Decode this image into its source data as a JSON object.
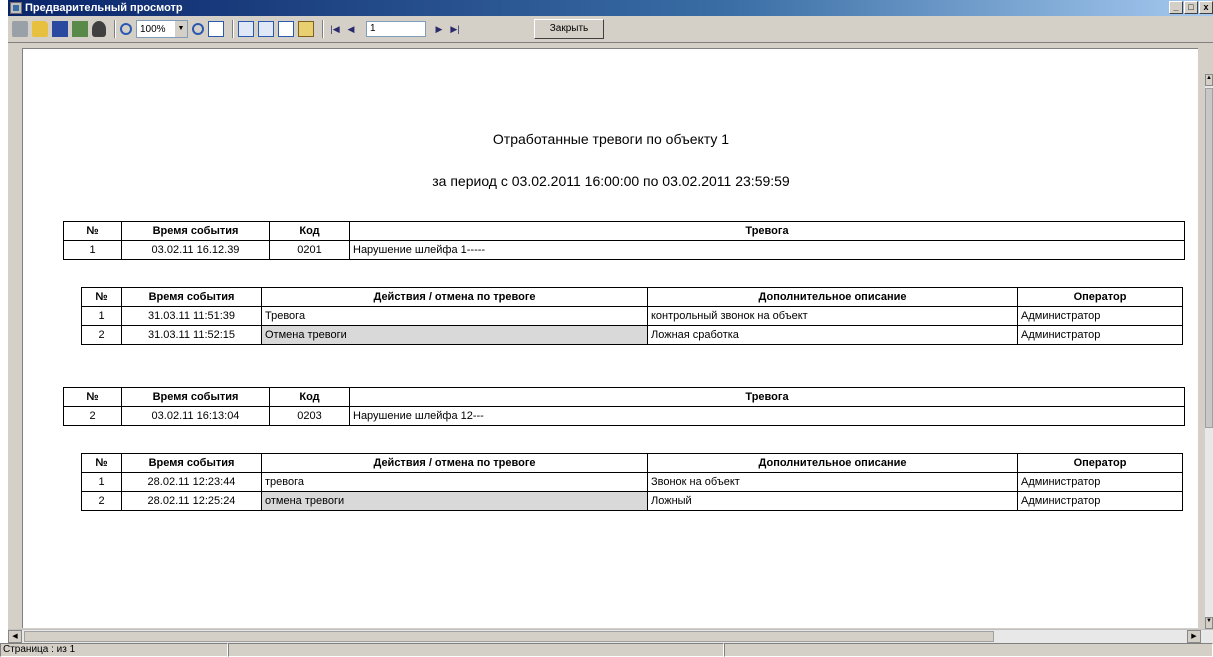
{
  "window": {
    "title": "Предварительный просмотр",
    "min_label": "_",
    "max_label": "□",
    "close_label": "x"
  },
  "toolbar": {
    "zoom_value": "100%",
    "page_value": "1",
    "close_label": "Закрыть",
    "first_label": "|◀",
    "prev_label": "◀",
    "next_label": "▶",
    "last_label": "▶|"
  },
  "report": {
    "title": "Отработанные тревоги по объекту   1",
    "period": "за период с 03.02.2011 16:00:00 по 03.02.2011 23:59:59",
    "alarm_headers": [
      "№",
      "Время события",
      "Код",
      "Тревога"
    ],
    "action_headers": [
      "№",
      "Время события",
      "Действия / отмена по тревоге",
      "Дополнительное описание",
      "Оператор"
    ],
    "alarms": [
      {
        "num": "1",
        "time": "03.02.11 16.12.39",
        "code": "0201",
        "desc": "Нарушение шлейфа  1-----",
        "actions": [
          {
            "num": "1",
            "time": "31.03.11 11:51:39",
            "action": "Тревога",
            "extra": "контрольный звонок на объект",
            "operator": "Администратор"
          },
          {
            "num": "2",
            "time": "31.03.11 11:52:15",
            "action": "Отмена тревоги",
            "extra": "Ложная сработка",
            "operator": "Администратор"
          }
        ]
      },
      {
        "num": "2",
        "time": "03.02.11 16:13:04",
        "code": "0203",
        "desc": "Нарушение шлейфа  12---",
        "actions": [
          {
            "num": "1",
            "time": "28.02.11 12:23:44",
            "action": "тревога",
            "extra": "Звонок на объект",
            "operator": "Администратор"
          },
          {
            "num": "2",
            "time": "28.02.11 12:25:24",
            "action": "отмена тревоги",
            "extra": "Ложный",
            "operator": "Администратор"
          }
        ]
      }
    ]
  },
  "status": {
    "page_info": "Страница : из 1"
  }
}
